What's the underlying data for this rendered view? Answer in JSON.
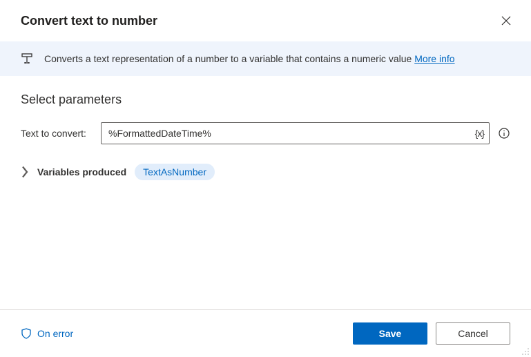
{
  "header": {
    "title": "Convert text to number"
  },
  "description": {
    "text": "Converts a text representation of a number to a variable that contains a numeric value ",
    "more_info": "More info"
  },
  "section": {
    "title": "Select parameters"
  },
  "param": {
    "label": "Text to convert:",
    "value": "%FormattedDateTime%",
    "var_icon_label": "{x}"
  },
  "vars_produced": {
    "label": "Variables produced",
    "chip": "TextAsNumber"
  },
  "footer": {
    "on_error": "On error",
    "save": "Save",
    "cancel": "Cancel"
  }
}
